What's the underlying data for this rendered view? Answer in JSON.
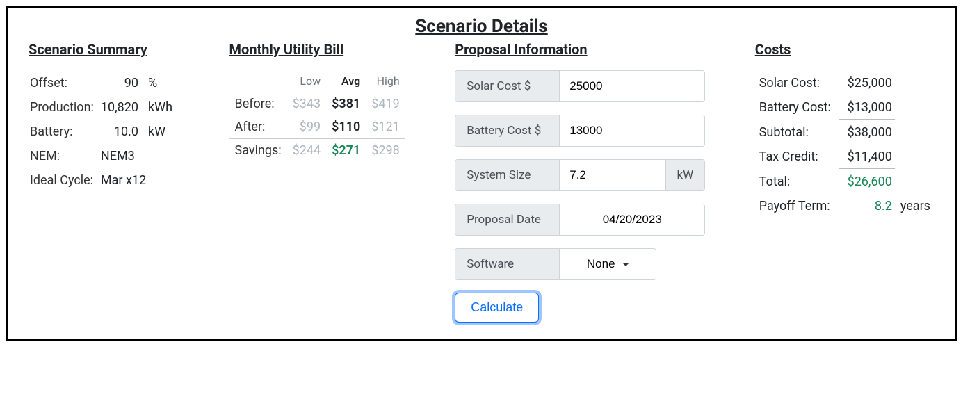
{
  "title": "Scenario Details",
  "summary": {
    "heading": "Scenario Summary",
    "rows": {
      "offset": {
        "label": "Offset:",
        "value": "90",
        "unit": "%"
      },
      "production": {
        "label": "Production:",
        "value": "10,820",
        "unit": "kWh"
      },
      "battery": {
        "label": "Battery:",
        "value": "10.0",
        "unit": "kW"
      },
      "nem": {
        "label": "NEM:",
        "value": "NEM3",
        "unit": ""
      },
      "ideal_cycle": {
        "label": "Ideal Cycle:",
        "value": "Mar x12",
        "unit": ""
      }
    }
  },
  "bill": {
    "heading": "Monthly Utility Bill",
    "headers": {
      "low": "Low",
      "avg": "Avg",
      "high": "High"
    },
    "rows": {
      "before": {
        "label": "Before:",
        "low": "$343",
        "avg": "$381",
        "high": "$419"
      },
      "after": {
        "label": "After:",
        "low": "$99",
        "avg": "$110",
        "high": "$121"
      },
      "savings": {
        "label": "Savings:",
        "low": "$244",
        "avg": "$271",
        "high": "$298"
      }
    }
  },
  "proposal": {
    "heading": "Proposal Information",
    "solar_cost": {
      "label": "Solar Cost $",
      "value": "25000"
    },
    "battery_cost": {
      "label": "Battery Cost $",
      "value": "13000"
    },
    "system_size": {
      "label": "System Size",
      "value": "7.2",
      "unit": "kW"
    },
    "proposal_date": {
      "label": "Proposal Date",
      "value": "04/20/2023"
    },
    "software": {
      "label": "Software",
      "selected": "None"
    },
    "calculate_label": "Calculate"
  },
  "costs": {
    "heading": "Costs",
    "rows": {
      "solar_cost": {
        "label": "Solar Cost:",
        "value": "$25,000"
      },
      "battery_cost": {
        "label": "Battery Cost:",
        "value": "$13,000"
      },
      "subtotal": {
        "label": "Subtotal:",
        "value": "$38,000"
      },
      "tax_credit": {
        "label": "Tax Credit:",
        "value": "$11,400"
      },
      "total": {
        "label": "Total:",
        "value": "$26,600"
      },
      "payoff_term": {
        "label": "Payoff Term:",
        "value": "8.2",
        "unit": "years"
      }
    }
  }
}
